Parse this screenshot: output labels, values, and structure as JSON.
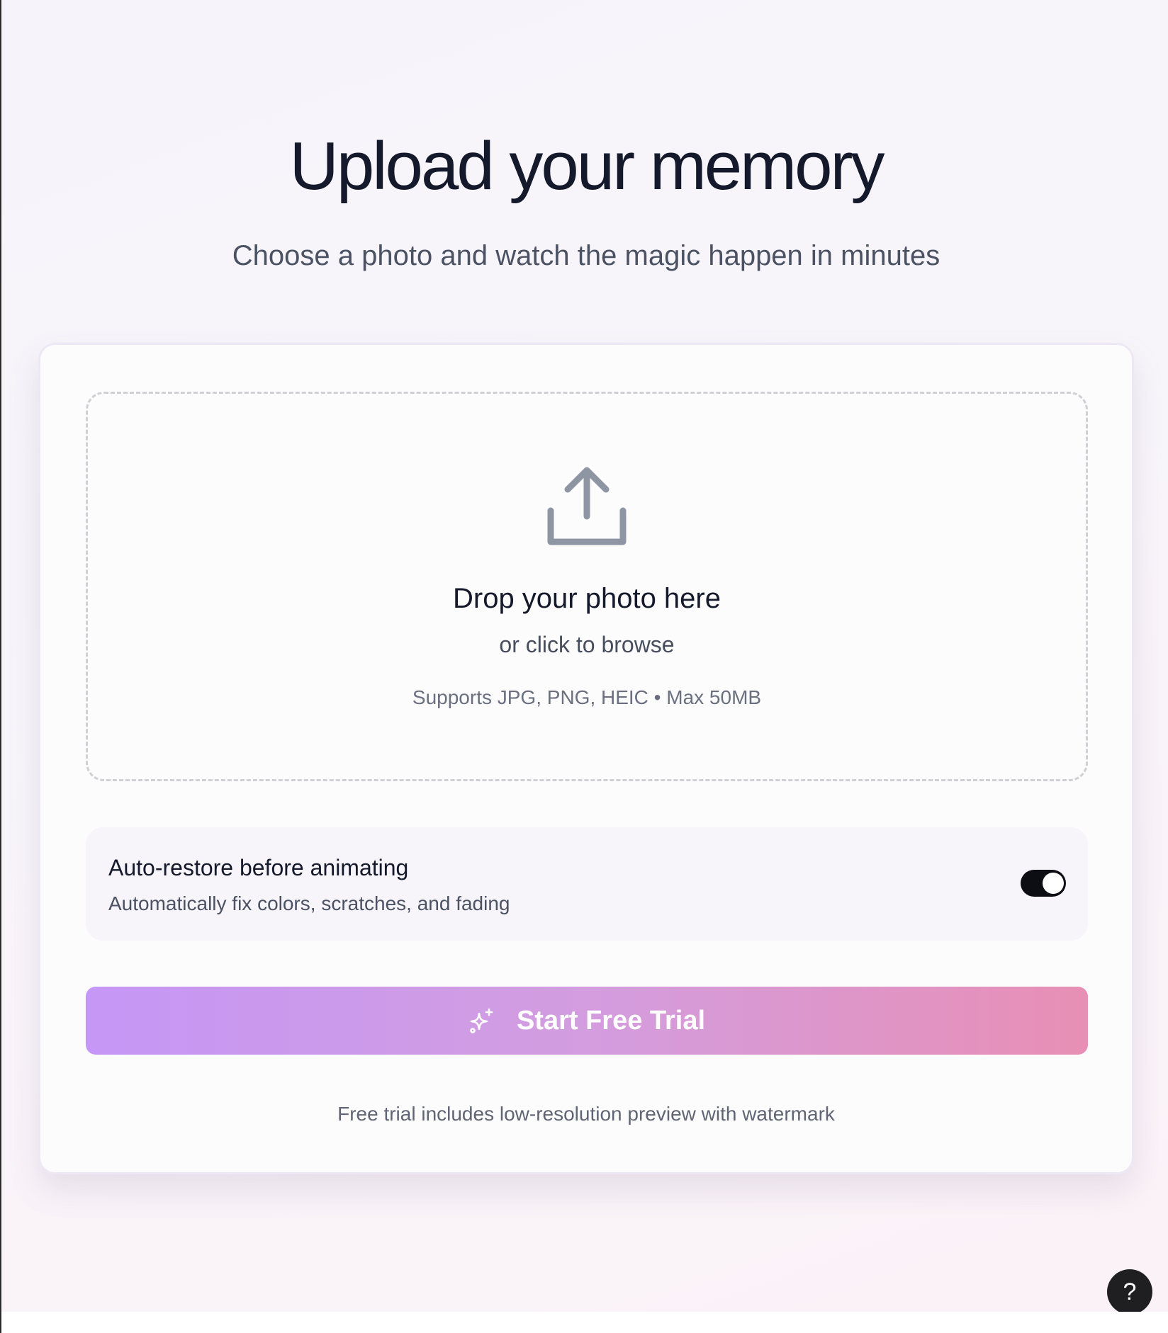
{
  "header": {
    "title": "Upload your memory",
    "subtitle": "Choose a photo and watch the magic happen in minutes"
  },
  "dropzone": {
    "icon": "upload-icon",
    "title": "Drop your photo here",
    "browse_text": "or click to browse",
    "formats_text": "Supports JPG, PNG, HEIC • Max 50MB"
  },
  "auto_restore": {
    "title": "Auto-restore before animating",
    "description": "Automatically fix colors, scratches, and fading",
    "enabled": true
  },
  "cta": {
    "icon": "sparkle-icon",
    "label": "Start Free Trial",
    "gradient_start": "#c597f6",
    "gradient_end": "#e88fb5"
  },
  "fine_print": "Free trial includes low-resolution preview with watermark",
  "help": {
    "icon": "help-icon",
    "label": "?"
  }
}
